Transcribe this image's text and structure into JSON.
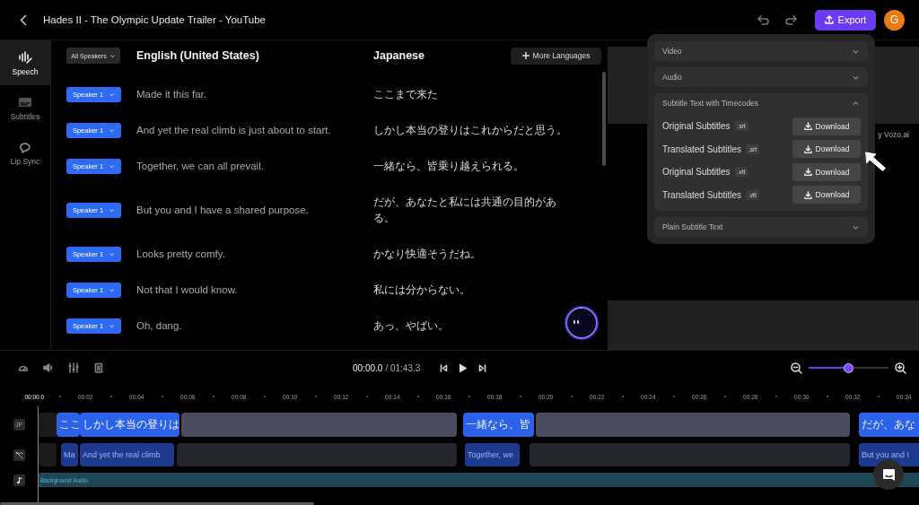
{
  "header": {
    "title": "Hades II - The Olympic Update Trailer - YouTube",
    "export_label": "Export",
    "avatar": "G"
  },
  "sidebar": {
    "items": [
      {
        "kind": "speech",
        "label": "Speech",
        "selected": true
      },
      {
        "kind": "subtitles",
        "label": "Subtitles",
        "selected": false
      },
      {
        "kind": "lipsync",
        "label": "Lip Sync",
        "selected": false
      }
    ]
  },
  "transcript": {
    "speaker_filter": "All Speakers",
    "source_language": "English (United States)",
    "target_language": "Japanese",
    "more_languages": "More Languages",
    "rows": [
      {
        "speaker": "Speaker 1",
        "source": "Made it this far.",
        "target": "ここまで来た"
      },
      {
        "speaker": "Speaker 1",
        "source": "And yet the real climb is just about to start.",
        "target": "しかし本当の登りはこれからだと思う。"
      },
      {
        "speaker": "Speaker 1",
        "source": "Together, we can all prevail.",
        "target": "一緒なら、皆乗り越えられる。"
      },
      {
        "speaker": "Speaker 1",
        "source": "But you and I have a shared purpose.",
        "target": "だが、あなたと私には共通の目的がある。"
      },
      {
        "speaker": "Speaker 1",
        "source": "Looks pretty comfy.",
        "target": "かなり快適そうだね。"
      },
      {
        "speaker": "Speaker 1",
        "source": "Not that I would know.",
        "target": "私には分からない。"
      },
      {
        "speaker": "Speaker 1",
        "source": "Oh, dang.",
        "target": "あっ、やばい。"
      }
    ]
  },
  "preview": {
    "credit": "y Vozo.ai"
  },
  "export_menu": {
    "sections": [
      {
        "title": "Video",
        "expanded": false
      },
      {
        "title": "Audio",
        "expanded": false
      },
      {
        "title": "Subtitle Text with Timecodes",
        "expanded": true,
        "files": [
          {
            "label": "Original Subtitles",
            "format": ".srt",
            "action": "Download"
          },
          {
            "label": "Translated Subtitles",
            "format": ".srt",
            "action": "Download"
          },
          {
            "label": "Original Subtitles",
            "format": ".vtt",
            "action": "Download"
          },
          {
            "label": "Translated Subtitles",
            "format": ".vtt",
            "action": "Download"
          }
        ]
      },
      {
        "title": "Plain Subtitle Text",
        "expanded": false
      }
    ]
  },
  "timeline": {
    "current_time": "00:00.0",
    "duration": "/ 01:43.3",
    "zoom": {
      "level": 0.49
    },
    "ruler": [
      "00:00.0",
      "00:02",
      "00:04",
      "00:06",
      "00:08",
      "00:10",
      "00:12",
      "00:14",
      "00:16",
      "00:18",
      "00:20",
      "00:22",
      "00:24",
      "00:26",
      "00:28",
      "00:30",
      "00:32",
      "00:34"
    ],
    "tracks": [
      {
        "kind": "translation",
        "badge": "JP",
        "clips": [
          {
            "kind": "empty"
          },
          {
            "kind": "subtitle",
            "text": "ここ"
          },
          {
            "kind": "subtitle",
            "text": "しかし本当の登りは"
          },
          {
            "kind": "gap"
          },
          {
            "kind": "subtitle",
            "text": "一緒なら、皆"
          },
          {
            "kind": "gap"
          },
          {
            "kind": "subtitle",
            "text": "だが、あな"
          }
        ]
      },
      {
        "kind": "original",
        "clips": [
          {
            "kind": "empty"
          },
          {
            "kind": "subtitle",
            "text": "Ma"
          },
          {
            "kind": "subtitle",
            "text": "And yet the real climb"
          },
          {
            "kind": "gap"
          },
          {
            "kind": "subtitle",
            "text": "Together, we"
          },
          {
            "kind": "gap"
          },
          {
            "kind": "subtitle",
            "text": "But you and I"
          }
        ]
      },
      {
        "kind": "audio",
        "clips": [
          {
            "kind": "audio",
            "text": "Background Audio"
          }
        ]
      }
    ]
  }
}
